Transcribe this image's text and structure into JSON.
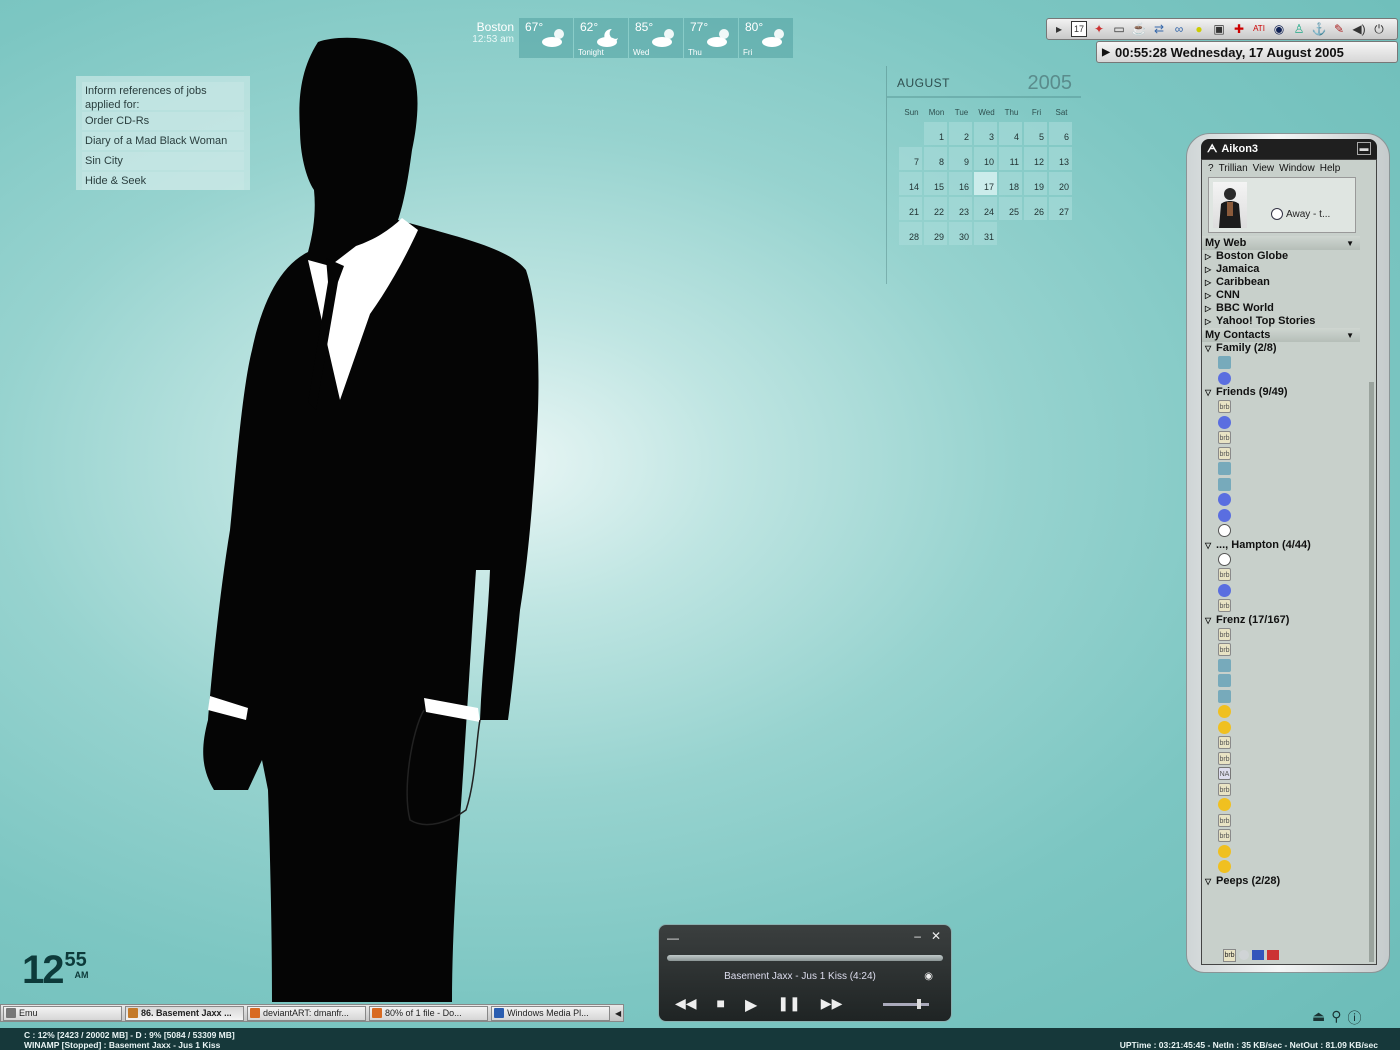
{
  "todo": {
    "items": [
      "Inform references of jobs applied for:",
      "Order CD-Rs",
      "Diary of a Mad Black Woman",
      "Sin City",
      "Hide & Seek"
    ]
  },
  "weather": {
    "city": "Boston",
    "time": "12:53 am",
    "days": [
      {
        "temp": "67°",
        "label": "",
        "icon": "partly-cloudy-icon"
      },
      {
        "temp": "62°",
        "label": "Tonight",
        "icon": "moon-cloud-icon"
      },
      {
        "temp": "85°",
        "label": "Wed",
        "icon": "partly-sunny-icon"
      },
      {
        "temp": "77°",
        "label": "Thu",
        "icon": "partly-sunny-icon"
      },
      {
        "temp": "80°",
        "label": "Fri",
        "icon": "partly-sunny-icon"
      }
    ]
  },
  "calendar": {
    "month": "AUGUST",
    "year": "2005",
    "dow": [
      "Sun",
      "Mon",
      "Tue",
      "Wed",
      "Thu",
      "Fri",
      "Sat"
    ],
    "first_weekday_offset": 1,
    "days_in_month": 31,
    "today": 17
  },
  "tray": {
    "icons": [
      "calendar-icon",
      "flash-icon",
      "monitor-icon",
      "java-icon",
      "network-icon",
      "link-icon",
      "norton-icon",
      "app-icon",
      "acrobat-icon",
      "ati-icon",
      "quicktime-icon",
      "messenger-icon",
      "antivirus-icon",
      "chat-icon",
      "volume-icon",
      "power-icon"
    ],
    "clock": "00:55:28  Wednesday, 17 August 2005"
  },
  "trillian": {
    "title": "Aikon3",
    "menu": [
      "?",
      "Trillian",
      "View",
      "Window",
      "Help"
    ],
    "status": "Away - t...",
    "sections": [
      {
        "name": "My Web",
        "type": "web",
        "items": [
          "Boston Globe",
          "Jamaica",
          "Caribbean",
          "CNN",
          "BBC World",
          "Yahoo! Top Stories"
        ]
      },
      {
        "name": "My Contacts",
        "type": "contacts"
      }
    ],
    "groups": [
      {
        "name": "Family (2/8)",
        "contacts": [
          "mob",
          "on"
        ]
      },
      {
        "name": "Friends (9/49)",
        "contacts": [
          "brb",
          "on",
          "brb",
          "brb",
          "mob",
          "mob",
          "on",
          "on",
          "idle"
        ]
      },
      {
        "name": "..., Hampton (4/44)",
        "contacts": [
          "idle",
          "brb",
          "on",
          "brb"
        ]
      },
      {
        "name": "Frenz (17/167)",
        "contacts": [
          "brb",
          "brb",
          "mob",
          "mob",
          "mob",
          "away",
          "away",
          "brb",
          "brb",
          "na",
          "brb",
          "away",
          "brb",
          "brb",
          "away",
          "away"
        ]
      },
      {
        "name": "Peeps (2/28)",
        "contacts": []
      }
    ]
  },
  "bigclock": {
    "hour": "12",
    "minute": "55",
    "ampm": "AM"
  },
  "player": {
    "track": "Basement Jaxx - Jus 1 Kiss (4:24)",
    "controls": [
      "rewind-icon",
      "stop-icon",
      "play-icon",
      "pause-icon",
      "fast-forward-icon"
    ]
  },
  "taskbar": {
    "tasks": [
      "Emu",
      "86. Basement Jaxx ...",
      "deviantART: dmanfr...",
      "80% of 1 file - Do...",
      "Windows Media Pl..."
    ]
  },
  "status": {
    "line1": "C : 12% [2423 / 20002 MB] - D : 9% [5084 / 53309 MB]",
    "line2": "WINAMP [Stopped] : Basement Jaxx - Jus 1 Kiss",
    "right": "UPTime : 03:21:45:45 - NetIn : 35 KB/sec - NetOut : 81.09 KB/sec"
  }
}
